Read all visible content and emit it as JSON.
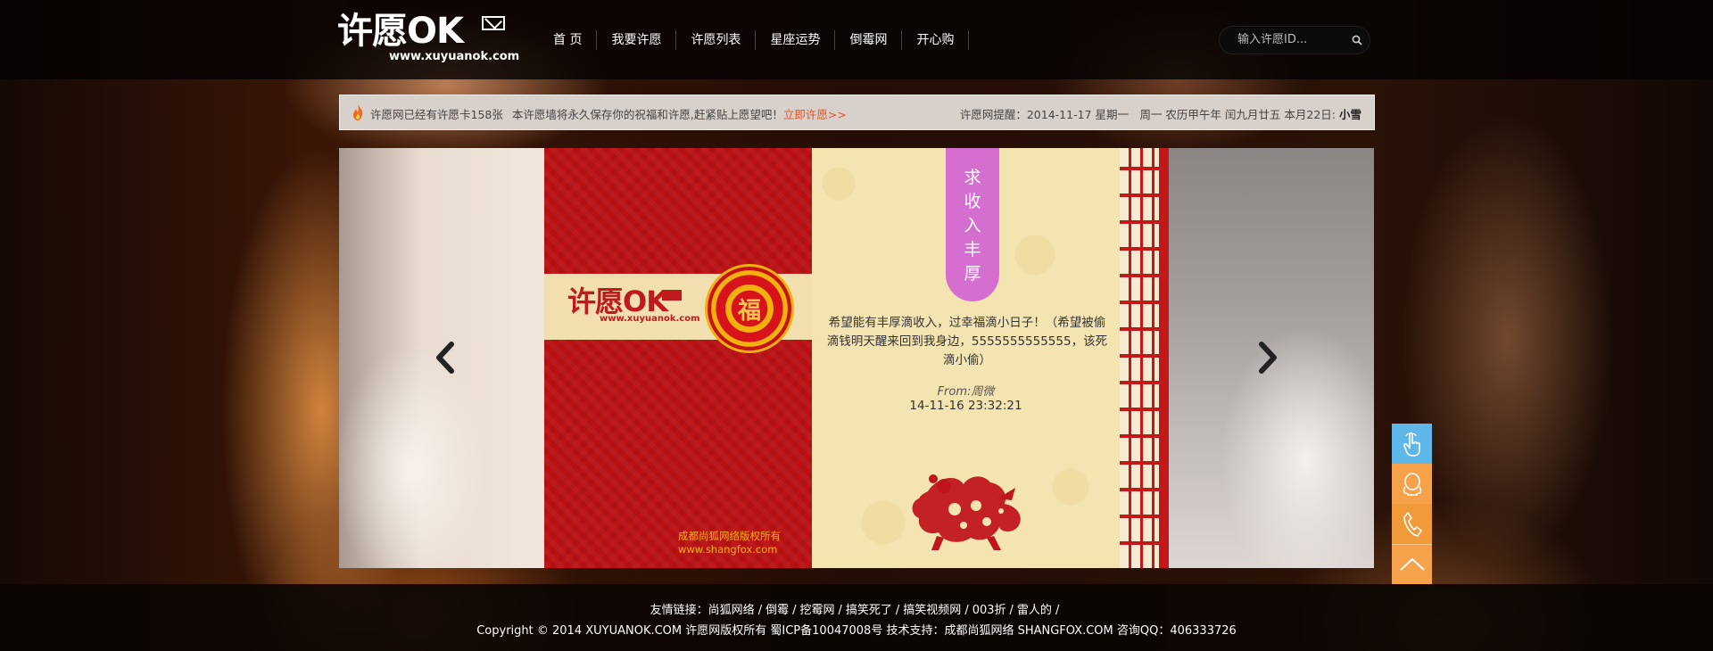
{
  "header": {
    "logo_text": "许愿OK",
    "logo_url": "www.xuyuanok.com",
    "nav": [
      "首 页",
      "我要许愿",
      "许愿列表",
      "星座运势",
      "倒霉网",
      "开心购"
    ],
    "search_placeholder": "输入许愿ID..."
  },
  "notice": {
    "left": "许愿网已经有许愿卡158张",
    "left2": "本许愿墙将永久保存你的祝福和许愿,赶紧贴上愿望吧！",
    "link": "立即许愿>>",
    "right": "许愿网提醒：2014-11-17 星期一　周一 农历甲午年 闰九月廿五 本月22日:",
    "right_bold": "小雪"
  },
  "card": {
    "logo_text": "许愿OK",
    "logo_url": "www.xuyuanok.com",
    "medallion_char": "福",
    "copyright_line1": "成都尚狐网络版权所有",
    "copyright_line2": "www.shangfox.com",
    "tag": "求收入丰厚",
    "wish": "希望能有丰厚滴收入，过幸福滴小日子！（希望被偷滴钱明天醒来回到我身边，5555555555555，该死滴小偷）",
    "from": "From:周微",
    "time": "14-11-16 23:32:21"
  },
  "footer": {
    "links_label": "友情链接：",
    "links": [
      "尚狐网络",
      "倒霉",
      "挖霉网",
      "搞笑死了",
      "搞笑视频网",
      "003折",
      "雷人的"
    ],
    "separator": "/",
    "copyright": "Copyright © 2014 XUYUANOK.COM 许愿网版权所有 蜀ICP备10047008号  技术支持：成都尚狐网络 SHANGFOX.COM  咨询QQ：406333726"
  },
  "colors": {
    "accent": "#e8511f",
    "card_red": "#bc1214",
    "tag_purple": "#d46fcf",
    "side_blue": "#5fb6e8",
    "side_orange": "#f6a24a"
  },
  "icons": [
    "fire-icon",
    "search-icon",
    "chevron-left-icon",
    "chevron-right-icon",
    "hand-touch-icon",
    "qq-penguin-icon",
    "phone-icon",
    "arrow-up-icon"
  ]
}
